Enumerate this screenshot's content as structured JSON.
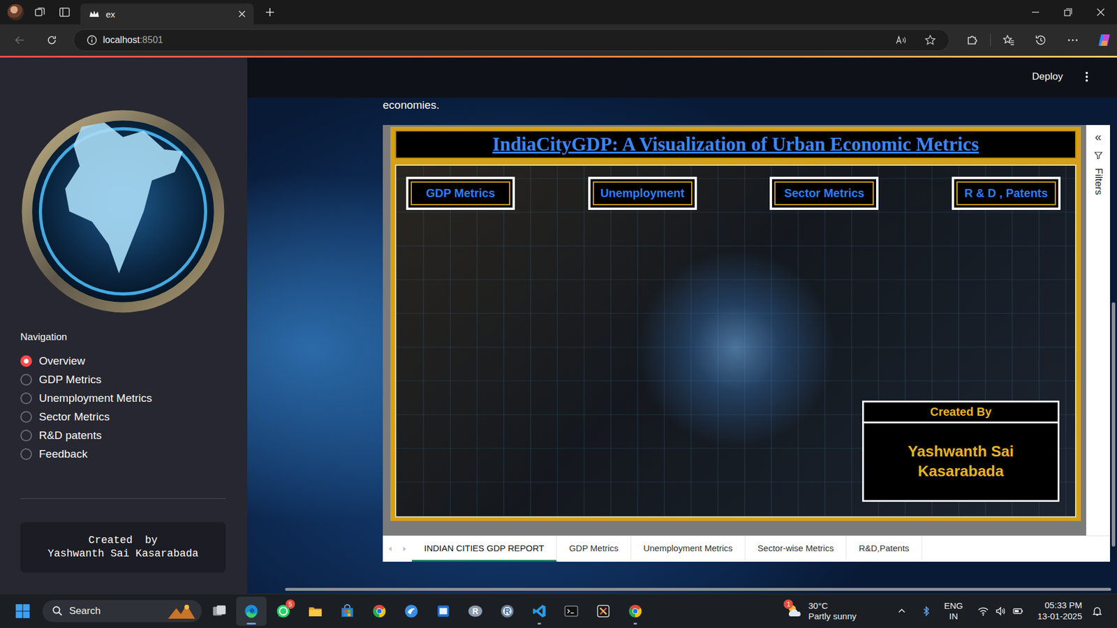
{
  "browser": {
    "tab_title": "ex",
    "address_host": "localhost",
    "address_port": ":8501"
  },
  "app_header": {
    "deploy": "Deploy"
  },
  "sidebar": {
    "nav_label": "Navigation",
    "items": [
      {
        "label": "Overview",
        "selected": true
      },
      {
        "label": "GDP Metrics",
        "selected": false
      },
      {
        "label": "Unemployment Metrics",
        "selected": false
      },
      {
        "label": "Sector Metrics",
        "selected": false
      },
      {
        "label": "R&D patents",
        "selected": false
      },
      {
        "label": "Feedback",
        "selected": false
      }
    ],
    "credit_lines": [
      "Created  by",
      "Yashwanth Sai Kasarabada"
    ]
  },
  "intro_text": "economies.",
  "report": {
    "title": "IndiaCityGDP: A Visualization of Urban Economic Metrics",
    "buttons": [
      "GDP Metrics",
      "Unemployment",
      "Sector Metrics",
      "R & D , Patents"
    ],
    "credit_heading": "Created By",
    "credit_name": "Yashwanth Sai Kasarabada",
    "filters_label": "Filters",
    "filters_collapse": "«",
    "pages": [
      {
        "label": "INDIAN CITIES GDP REPORT",
        "selected": true
      },
      {
        "label": "GDP Metrics",
        "selected": false
      },
      {
        "label": "Unemployment Metrics",
        "selected": false
      },
      {
        "label": "Sector-wise Metrics",
        "selected": false
      },
      {
        "label": "R&D,Patents",
        "selected": false
      }
    ]
  },
  "taskbar": {
    "search": "Search",
    "apps": [
      {
        "kind": "files",
        "running": false,
        "selected": false,
        "badge": "",
        "glyph": ""
      },
      {
        "kind": "edge",
        "running": true,
        "selected": true,
        "badge": "",
        "glyph": ""
      },
      {
        "kind": "whatsapp",
        "running": false,
        "selected": false,
        "badge": "5",
        "glyph": ""
      },
      {
        "kind": "explorer",
        "running": false,
        "selected": false,
        "badge": "",
        "glyph": ""
      },
      {
        "kind": "store",
        "running": false,
        "selected": false,
        "badge": "",
        "glyph": ""
      },
      {
        "kind": "chrome",
        "running": false,
        "selected": false,
        "badge": "",
        "glyph": ""
      },
      {
        "kind": "feedback",
        "running": false,
        "selected": false,
        "badge": "",
        "glyph": ""
      },
      {
        "kind": "news",
        "running": false,
        "selected": false,
        "badge": "",
        "glyph": ""
      },
      {
        "kind": "r",
        "running": false,
        "selected": false,
        "badge": "",
        "glyph": "R"
      },
      {
        "kind": "rstudio",
        "running": false,
        "selected": false,
        "badge": "",
        "glyph": "R"
      },
      {
        "kind": "vscode",
        "running": true,
        "selected": false,
        "badge": "",
        "glyph": ""
      },
      {
        "kind": "terminal",
        "running": false,
        "selected": false,
        "badge": "",
        "glyph": ""
      },
      {
        "kind": "snip",
        "running": false,
        "selected": false,
        "badge": "",
        "glyph": ""
      },
      {
        "kind": "chrome",
        "running": true,
        "selected": false,
        "badge": "",
        "glyph": ""
      }
    ],
    "weather": {
      "badge": "1",
      "temp": "30°C",
      "desc": "Partly sunny"
    },
    "tray": {
      "lang": "ENG",
      "region": "IN",
      "time": "05:33 PM",
      "date": "13-01-2025"
    }
  }
}
